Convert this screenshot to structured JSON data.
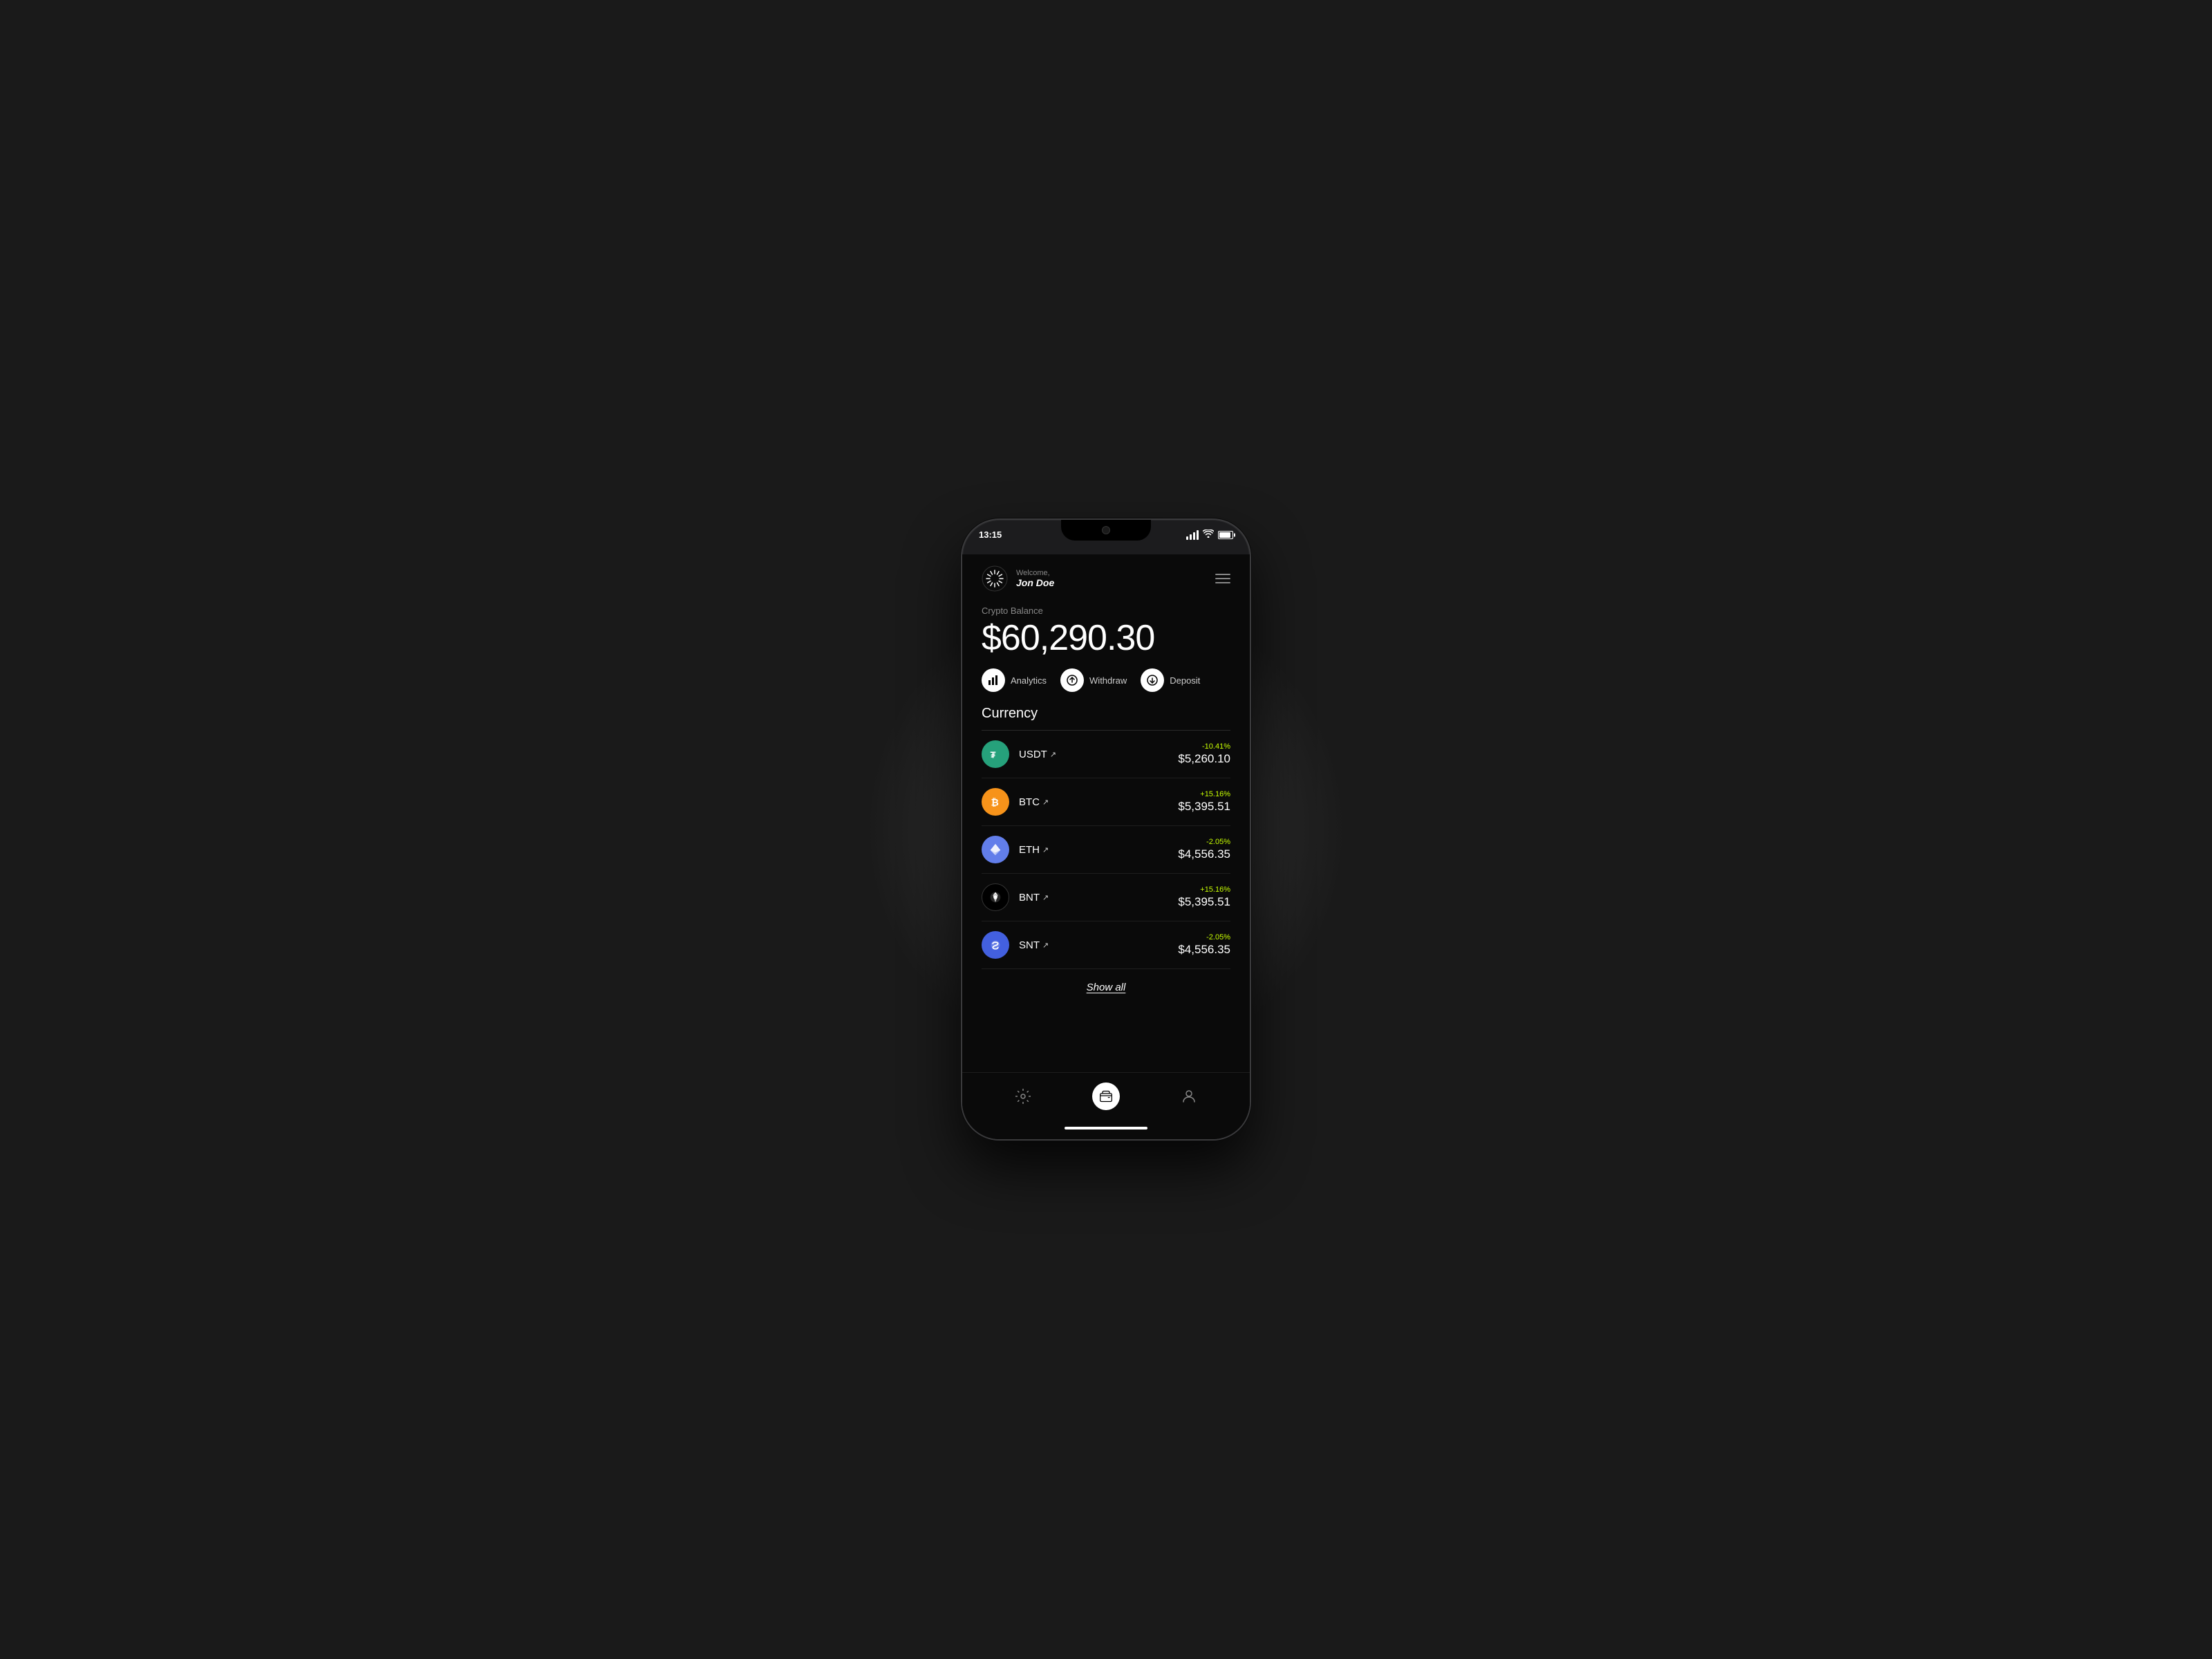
{
  "status_bar": {
    "time": "13:15",
    "signal_label": "signal",
    "wifi_label": "wifi",
    "battery_label": "battery"
  },
  "header": {
    "welcome_label": "Welcome,",
    "user_name": "Jon Doe",
    "menu_label": "menu"
  },
  "balance": {
    "label": "Crypto Balance",
    "amount": "$60,290.30"
  },
  "actions": [
    {
      "id": "analytics",
      "label": "Analytics",
      "icon": "bar-chart-icon"
    },
    {
      "id": "withdraw",
      "label": "Withdraw",
      "icon": "arrow-up-icon"
    },
    {
      "id": "deposit",
      "label": "Deposit",
      "icon": "arrow-down-icon"
    }
  ],
  "currency_section": {
    "title": "Currency"
  },
  "currencies": [
    {
      "id": "usdt",
      "symbol": "USDT",
      "change": "-10.41%",
      "change_type": "negative",
      "value": "$5,260.10"
    },
    {
      "id": "btc",
      "symbol": "BTC",
      "change": "+15.16%",
      "change_type": "positive",
      "value": "$5,395.51"
    },
    {
      "id": "eth",
      "symbol": "ETH",
      "change": "-2.05%",
      "change_type": "negative",
      "value": "$4,556.35"
    },
    {
      "id": "bnt",
      "symbol": "BNT",
      "change": "+15.16%",
      "change_type": "positive",
      "value": "$5,395.51"
    },
    {
      "id": "snt",
      "symbol": "SNT",
      "change": "-2.05%",
      "change_type": "negative",
      "value": "$4,556.35"
    }
  ],
  "show_all": {
    "label": "Show all"
  },
  "bottom_nav": [
    {
      "id": "settings",
      "label": "Settings",
      "icon": "gear-icon",
      "active": false
    },
    {
      "id": "wallet",
      "label": "Wallet",
      "icon": "wallet-icon",
      "active": true
    },
    {
      "id": "profile",
      "label": "Profile",
      "icon": "person-icon",
      "active": false
    }
  ]
}
